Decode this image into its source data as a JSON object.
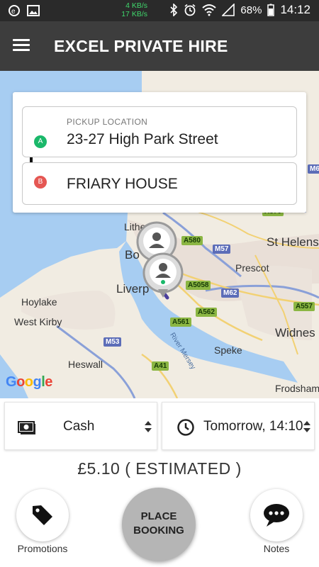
{
  "status_bar": {
    "net_up": "4 KB/s",
    "net_down": "17 KB/s",
    "battery": "68%",
    "time": "14:12"
  },
  "app_bar": {
    "title": "EXCEL PRIVATE HIRE",
    "menu_icon": "hamburger-menu-icon"
  },
  "locations": {
    "pickup_label": "PICKUP LOCATION",
    "pickup_value": "23-27 High Park Street",
    "pickup_pin": "A",
    "dropoff_value": "FRIARY HOUSE",
    "dropoff_pin": "B"
  },
  "map": {
    "labels": [
      "Litherl",
      "Bo",
      "Liverp",
      "Hoylake",
      "West Kirby",
      "Heswall",
      "Prescot",
      "St Helens",
      "Widnes",
      "Speke",
      "Frodsham",
      "River Mersey"
    ],
    "roads": [
      "A580",
      "M57",
      "A5058",
      "M62",
      "A562",
      "A561",
      "A557",
      "M53",
      "A41",
      "A570",
      "M6"
    ],
    "attribution": "Google"
  },
  "payment": {
    "icon": "cash-icon",
    "value": "Cash"
  },
  "schedule": {
    "icon": "clock-icon",
    "value": "Tomorrow, 14:10"
  },
  "price": {
    "text": "£5.10 ( ESTIMATED )"
  },
  "actions": {
    "promotions_label": "Promotions",
    "promotions_icon": "tag-icon",
    "book_line1": "PLACE",
    "book_line2": "BOOKING",
    "notes_label": "Notes",
    "notes_icon": "chat-bubble-icon"
  },
  "colors": {
    "app_bar": "#3d3d3d",
    "pin_a": "#1ab86a",
    "pin_b": "#e55753",
    "water": "#a7cdf2",
    "land": "#f1ece2",
    "book_button": "#b5b5b5"
  }
}
